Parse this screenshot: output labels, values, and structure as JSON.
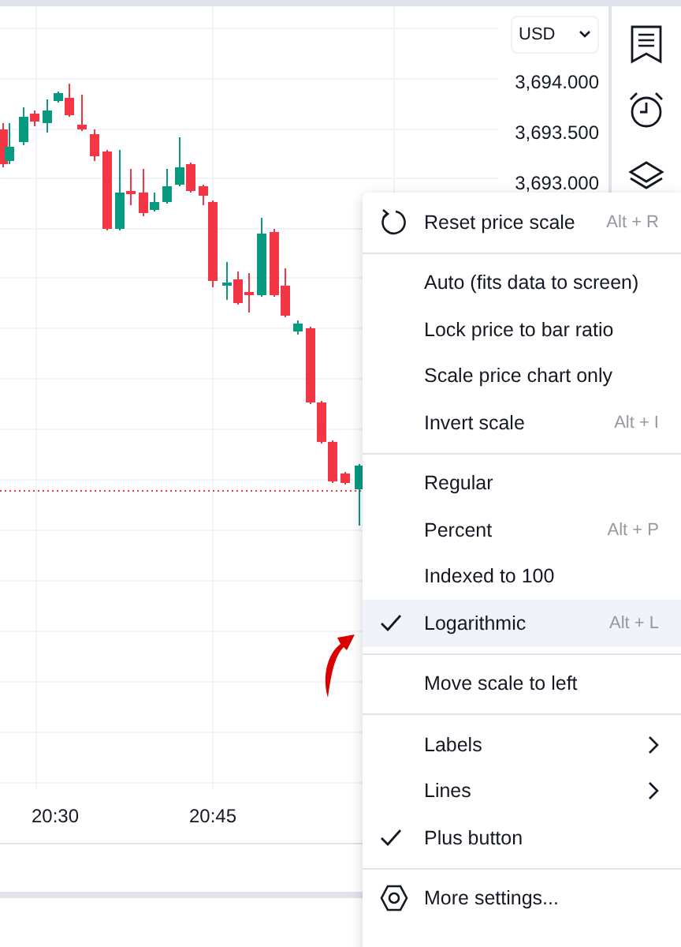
{
  "price_axis": {
    "currency": "USD",
    "labels": [
      "3,694.000",
      "3,693.500",
      "3,693.000"
    ]
  },
  "time_axis": {
    "labels": [
      "20:30",
      "20:45"
    ]
  },
  "context_menu": {
    "sections": [
      {
        "items": [
          {
            "kind": "reset",
            "label": "Reset price scale",
            "shortcut": "Alt + R",
            "checked": false,
            "highlighted": false
          }
        ]
      },
      {
        "items": [
          {
            "kind": "action",
            "label": "Auto (fits data to screen)",
            "checked": false,
            "highlighted": false
          },
          {
            "kind": "action",
            "label": "Lock price to bar ratio",
            "checked": false,
            "highlighted": false
          },
          {
            "kind": "action",
            "label": "Scale price chart only",
            "checked": false,
            "highlighted": false
          },
          {
            "kind": "action",
            "label": "Invert scale",
            "shortcut": "Alt + I",
            "checked": false,
            "highlighted": false
          }
        ]
      },
      {
        "items": [
          {
            "kind": "action",
            "label": "Regular",
            "checked": false,
            "highlighted": false
          },
          {
            "kind": "action",
            "label": "Percent",
            "shortcut": "Alt + P",
            "checked": false,
            "highlighted": false
          },
          {
            "kind": "action",
            "label": "Indexed to 100",
            "checked": false,
            "highlighted": false
          },
          {
            "kind": "action",
            "label": "Logarithmic",
            "shortcut": "Alt + L",
            "checked": true,
            "highlighted": true
          }
        ]
      },
      {
        "items": [
          {
            "kind": "action",
            "label": "Move scale to left",
            "checked": false,
            "highlighted": false
          }
        ]
      },
      {
        "items": [
          {
            "kind": "submenu",
            "label": "Labels",
            "checked": false,
            "highlighted": false
          },
          {
            "kind": "submenu",
            "label": "Lines",
            "checked": false,
            "highlighted": false
          },
          {
            "kind": "action",
            "label": "Plus button",
            "checked": true,
            "highlighted": false
          }
        ]
      },
      {
        "items": [
          {
            "kind": "settings",
            "label": "More settings...",
            "checked": false,
            "highlighted": false
          }
        ]
      }
    ]
  }
}
